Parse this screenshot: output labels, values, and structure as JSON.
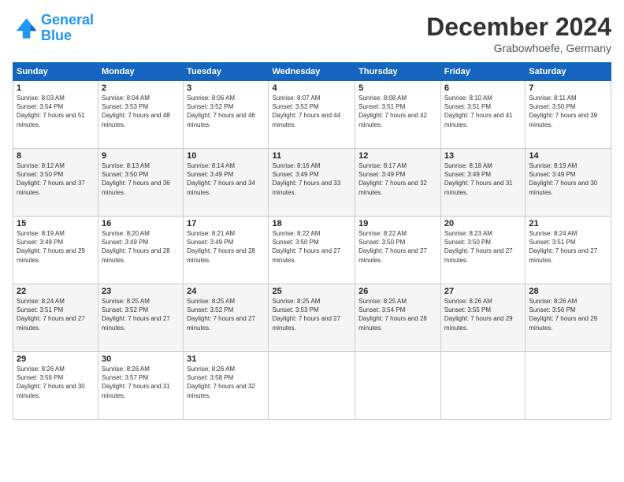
{
  "header": {
    "logo_line1": "General",
    "logo_line2": "Blue",
    "title": "December 2024",
    "subtitle": "Grabowhoefe, Germany"
  },
  "days_of_week": [
    "Sunday",
    "Monday",
    "Tuesday",
    "Wednesday",
    "Thursday",
    "Friday",
    "Saturday"
  ],
  "weeks": [
    [
      {
        "day": "1",
        "sunrise": "8:03 AM",
        "sunset": "3:54 PM",
        "daylight": "7 hours and 51 minutes."
      },
      {
        "day": "2",
        "sunrise": "8:04 AM",
        "sunset": "3:53 PM",
        "daylight": "7 hours and 48 minutes."
      },
      {
        "day": "3",
        "sunrise": "8:06 AM",
        "sunset": "3:52 PM",
        "daylight": "7 hours and 46 minutes."
      },
      {
        "day": "4",
        "sunrise": "8:07 AM",
        "sunset": "3:52 PM",
        "daylight": "7 hours and 44 minutes."
      },
      {
        "day": "5",
        "sunrise": "8:08 AM",
        "sunset": "3:51 PM",
        "daylight": "7 hours and 42 minutes."
      },
      {
        "day": "6",
        "sunrise": "8:10 AM",
        "sunset": "3:51 PM",
        "daylight": "7 hours and 41 minutes."
      },
      {
        "day": "7",
        "sunrise": "8:11 AM",
        "sunset": "3:50 PM",
        "daylight": "7 hours and 39 minutes."
      }
    ],
    [
      {
        "day": "8",
        "sunrise": "8:12 AM",
        "sunset": "3:50 PM",
        "daylight": "7 hours and 37 minutes."
      },
      {
        "day": "9",
        "sunrise": "8:13 AM",
        "sunset": "3:50 PM",
        "daylight": "7 hours and 36 minutes."
      },
      {
        "day": "10",
        "sunrise": "8:14 AM",
        "sunset": "3:49 PM",
        "daylight": "7 hours and 34 minutes."
      },
      {
        "day": "11",
        "sunrise": "8:16 AM",
        "sunset": "3:49 PM",
        "daylight": "7 hours and 33 minutes."
      },
      {
        "day": "12",
        "sunrise": "8:17 AM",
        "sunset": "3:49 PM",
        "daylight": "7 hours and 32 minutes."
      },
      {
        "day": "13",
        "sunrise": "8:18 AM",
        "sunset": "3:49 PM",
        "daylight": "7 hours and 31 minutes."
      },
      {
        "day": "14",
        "sunrise": "8:19 AM",
        "sunset": "3:49 PM",
        "daylight": "7 hours and 30 minutes."
      }
    ],
    [
      {
        "day": "15",
        "sunrise": "8:19 AM",
        "sunset": "3:49 PM",
        "daylight": "7 hours and 29 minutes."
      },
      {
        "day": "16",
        "sunrise": "8:20 AM",
        "sunset": "3:49 PM",
        "daylight": "7 hours and 28 minutes."
      },
      {
        "day": "17",
        "sunrise": "8:21 AM",
        "sunset": "3:49 PM",
        "daylight": "7 hours and 28 minutes."
      },
      {
        "day": "18",
        "sunrise": "8:22 AM",
        "sunset": "3:50 PM",
        "daylight": "7 hours and 27 minutes."
      },
      {
        "day": "19",
        "sunrise": "8:22 AM",
        "sunset": "3:50 PM",
        "daylight": "7 hours and 27 minutes."
      },
      {
        "day": "20",
        "sunrise": "8:23 AM",
        "sunset": "3:50 PM",
        "daylight": "7 hours and 27 minutes."
      },
      {
        "day": "21",
        "sunrise": "8:24 AM",
        "sunset": "3:51 PM",
        "daylight": "7 hours and 27 minutes."
      }
    ],
    [
      {
        "day": "22",
        "sunrise": "8:24 AM",
        "sunset": "3:51 PM",
        "daylight": "7 hours and 27 minutes."
      },
      {
        "day": "23",
        "sunrise": "8:25 AM",
        "sunset": "3:52 PM",
        "daylight": "7 hours and 27 minutes."
      },
      {
        "day": "24",
        "sunrise": "8:25 AM",
        "sunset": "3:52 PM",
        "daylight": "7 hours and 27 minutes."
      },
      {
        "day": "25",
        "sunrise": "8:25 AM",
        "sunset": "3:53 PM",
        "daylight": "7 hours and 27 minutes."
      },
      {
        "day": "26",
        "sunrise": "8:25 AM",
        "sunset": "3:54 PM",
        "daylight": "7 hours and 28 minutes."
      },
      {
        "day": "27",
        "sunrise": "8:26 AM",
        "sunset": "3:55 PM",
        "daylight": "7 hours and 29 minutes."
      },
      {
        "day": "28",
        "sunrise": "8:26 AM",
        "sunset": "3:56 PM",
        "daylight": "7 hours and 29 minutes."
      }
    ],
    [
      {
        "day": "29",
        "sunrise": "8:26 AM",
        "sunset": "3:56 PM",
        "daylight": "7 hours and 30 minutes."
      },
      {
        "day": "30",
        "sunrise": "8:26 AM",
        "sunset": "3:57 PM",
        "daylight": "7 hours and 31 minutes."
      },
      {
        "day": "31",
        "sunrise": "8:26 AM",
        "sunset": "3:58 PM",
        "daylight": "7 hours and 32 minutes."
      },
      null,
      null,
      null,
      null
    ]
  ]
}
